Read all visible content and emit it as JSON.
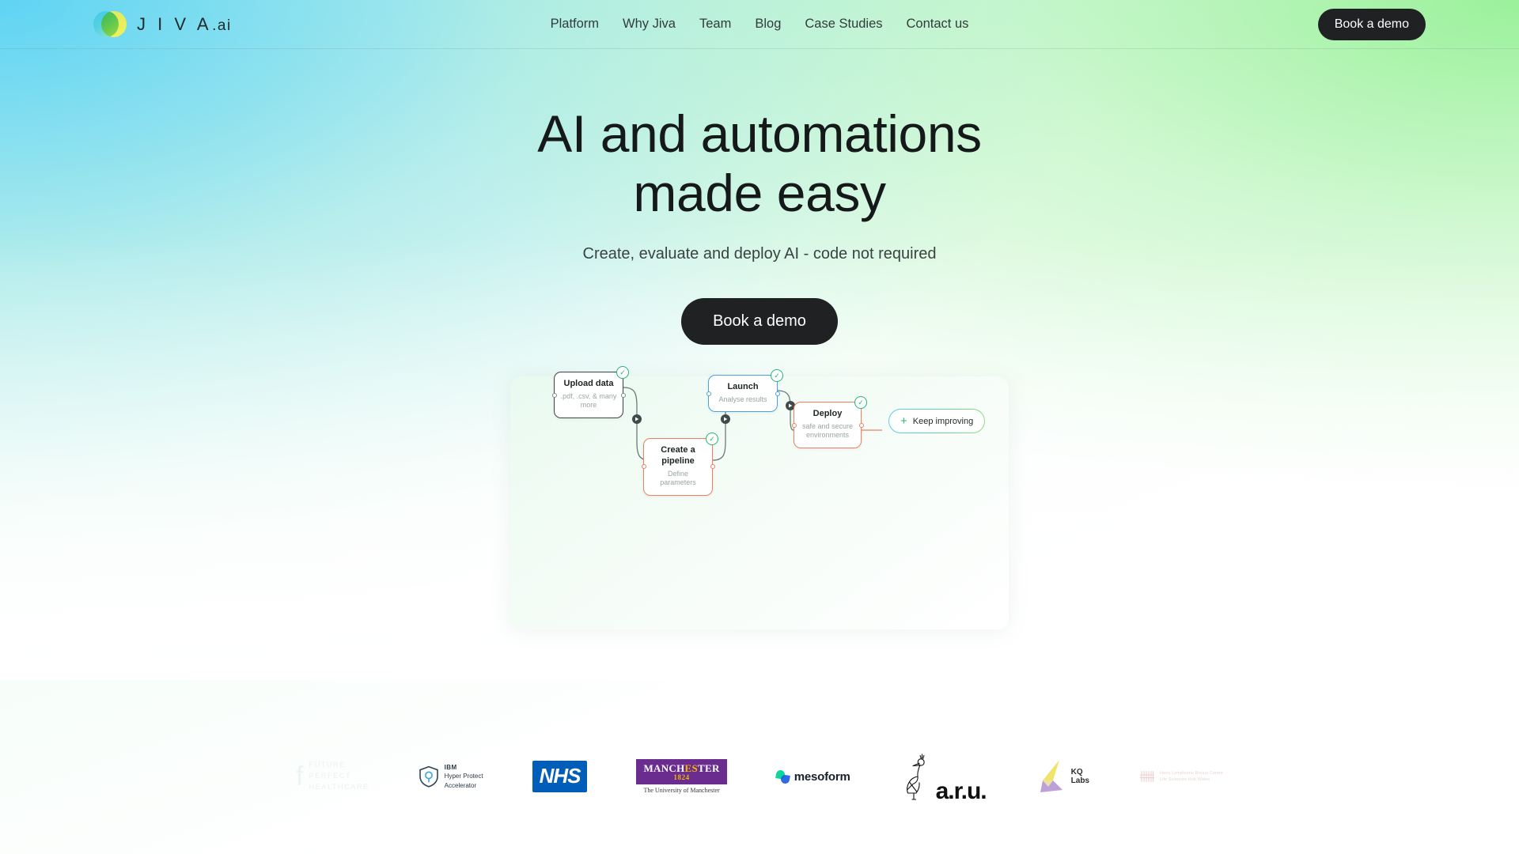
{
  "header": {
    "logo": {
      "text": "J I V A",
      "suffix": ".ai",
      "icon": "jiva-logo-circles"
    },
    "nav": [
      {
        "label": "Platform"
      },
      {
        "label": "Why Jiva"
      },
      {
        "label": "Team"
      },
      {
        "label": "Blog"
      },
      {
        "label": "Case Studies"
      },
      {
        "label": "Contact us"
      }
    ],
    "cta_label": "Book a demo"
  },
  "hero": {
    "title_line1": "AI and automations",
    "title_line2": "made easy",
    "subtitle": "Create, evaluate and deploy AI - code not required",
    "cta_label": "Book a demo"
  },
  "diagram": {
    "check_icon": "✓",
    "nodes": [
      {
        "id": "upload",
        "title": "Upload data",
        "desc": ".pdf, .csv, & many more",
        "color": "#3b4745"
      },
      {
        "id": "pipeline",
        "title": "Create a pipeline",
        "desc": "Define parameters",
        "color": "#ef7f5e"
      },
      {
        "id": "launch",
        "title": "Launch",
        "desc": "Analyse results",
        "color": "#4aa3e0"
      },
      {
        "id": "deploy",
        "title": "Deploy",
        "desc": "safe and secure environments",
        "color": "#ef7f5e"
      }
    ],
    "keep_improving": {
      "label": "Keep improving",
      "icon": "plus-icon",
      "plus": "+"
    }
  },
  "logos": [
    {
      "id": "future-perfect-healthcare",
      "name": "Future Perfect Healthcare",
      "line1": "FUTURE",
      "line2": "PERFECT",
      "line3": "HEALTHCARE",
      "f": "f"
    },
    {
      "id": "ibm-hyper-protect-accelerator",
      "name": "IBM Hyper Protect Accelerator",
      "line1": "IBM",
      "line2": "Hyper Protect",
      "line3": "Accelerator"
    },
    {
      "id": "nhs",
      "name": "NHS",
      "text": "NHS"
    },
    {
      "id": "university-of-manchester",
      "name": "The University of Manchester",
      "bar_pre": "MANCH",
      "bar_hl": "ES",
      "bar_post": "TER",
      "year": "1824",
      "caption": "The University of Manchester"
    },
    {
      "id": "mesoform",
      "name": "mesoform",
      "text": "mesoform"
    },
    {
      "id": "anglia-ruskin-university",
      "name": "Anglia Ruskin University",
      "text": "a.r.u."
    },
    {
      "id": "kq-labs",
      "name": "KQ Labs",
      "line1": "KQ",
      "line2": "Labs"
    },
    {
      "id": "research-centre",
      "name": "Research Centre",
      "line1": "Herts Lymphoma Breast Centre",
      "line2": "Life Sciences Hub Wales"
    }
  ]
}
